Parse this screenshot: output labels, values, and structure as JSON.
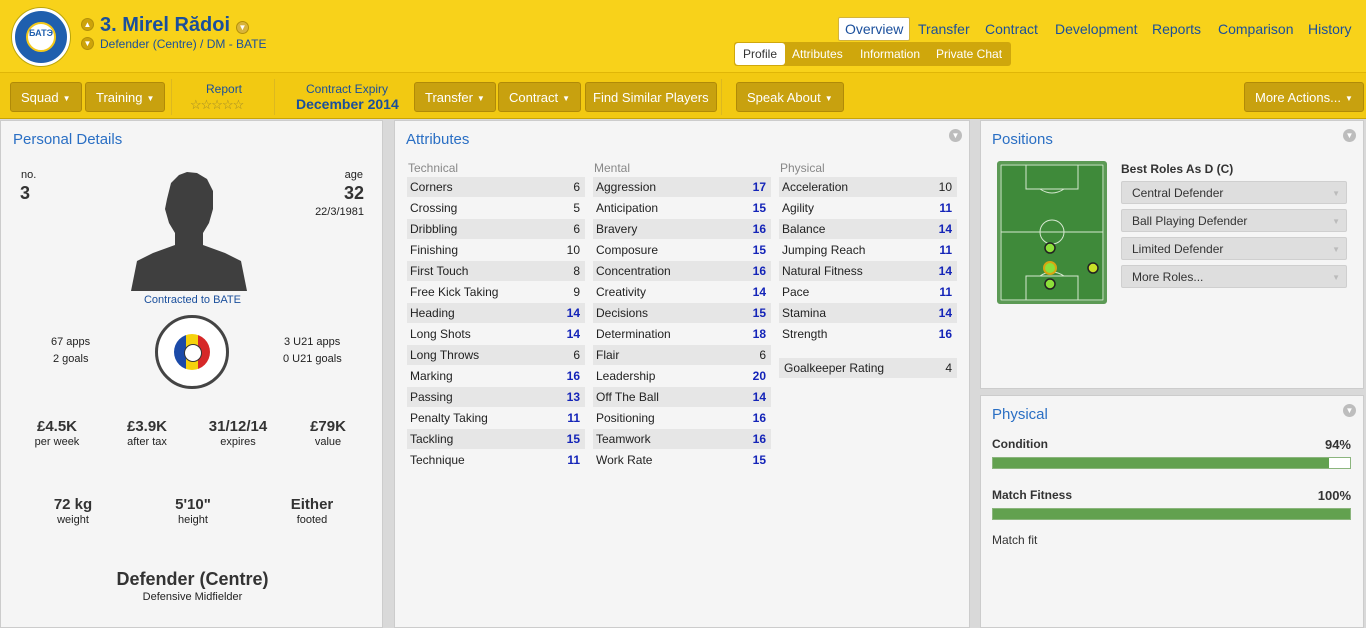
{
  "header": {
    "player_name": "3. Mirel Rădoi",
    "position_club": "Defender (Centre) / DM - BATE",
    "logo_text": "БАТЭ",
    "nav_tabs": [
      "Overview",
      "Transfer",
      "Contract",
      "Development",
      "Reports",
      "Comparison",
      "History"
    ],
    "sub_tabs": [
      "Profile",
      "Attributes",
      "Information",
      "Private Chat"
    ]
  },
  "toolbar": {
    "squad": "Squad",
    "training": "Training",
    "report_label": "Report",
    "report_stars": "☆☆☆☆☆",
    "contract_expiry_label": "Contract Expiry",
    "contract_expiry_value": "December 2014",
    "transfer": "Transfer",
    "contract": "Contract",
    "find_similar": "Find Similar Players",
    "speak_about": "Speak About",
    "more_actions": "More Actions..."
  },
  "personal": {
    "title": "Personal Details",
    "no_label": "no.",
    "no_value": "3",
    "age_label": "age",
    "age_value": "32",
    "dob": "22/3/1981",
    "contracted": "Contracted to BATE",
    "apps": "67 apps",
    "goals": "2 goals",
    "u21_apps": "3 U21 apps",
    "u21_goals": "0 U21 goals",
    "wage": "£4.5K",
    "wage_label": "per week",
    "after_tax": "£3.9K",
    "after_tax_label": "after tax",
    "expires": "31/12/14",
    "expires_label": "expires",
    "value": "£79K",
    "value_label": "value",
    "weight": "72 kg",
    "weight_label": "weight",
    "height": "5'10\"",
    "height_label": "height",
    "foot": "Either",
    "foot_label": "footed",
    "position_main": "Defender (Centre)",
    "position_sub": "Defensive Midfielder"
  },
  "attributes": {
    "title": "Attributes",
    "technical_label": "Technical",
    "mental_label": "Mental",
    "physical_label": "Physical",
    "technical": [
      {
        "name": "Corners",
        "value": "6"
      },
      {
        "name": "Crossing",
        "value": "5"
      },
      {
        "name": "Dribbling",
        "value": "6"
      },
      {
        "name": "Finishing",
        "value": "10"
      },
      {
        "name": "First Touch",
        "value": "8"
      },
      {
        "name": "Free Kick Taking",
        "value": "9"
      },
      {
        "name": "Heading",
        "value": "14"
      },
      {
        "name": "Long Shots",
        "value": "14"
      },
      {
        "name": "Long Throws",
        "value": "6"
      },
      {
        "name": "Marking",
        "value": "16"
      },
      {
        "name": "Passing",
        "value": "13"
      },
      {
        "name": "Penalty Taking",
        "value": "11"
      },
      {
        "name": "Tackling",
        "value": "15"
      },
      {
        "name": "Technique",
        "value": "11"
      }
    ],
    "mental": [
      {
        "name": "Aggression",
        "value": "17"
      },
      {
        "name": "Anticipation",
        "value": "15"
      },
      {
        "name": "Bravery",
        "value": "16"
      },
      {
        "name": "Composure",
        "value": "15"
      },
      {
        "name": "Concentration",
        "value": "16"
      },
      {
        "name": "Creativity",
        "value": "14"
      },
      {
        "name": "Decisions",
        "value": "15"
      },
      {
        "name": "Determination",
        "value": "18"
      },
      {
        "name": "Flair",
        "value": "6"
      },
      {
        "name": "Leadership",
        "value": "20"
      },
      {
        "name": "Off The Ball",
        "value": "14"
      },
      {
        "name": "Positioning",
        "value": "16"
      },
      {
        "name": "Teamwork",
        "value": "16"
      },
      {
        "name": "Work Rate",
        "value": "15"
      }
    ],
    "physical": [
      {
        "name": "Acceleration",
        "value": "10"
      },
      {
        "name": "Agility",
        "value": "11"
      },
      {
        "name": "Balance",
        "value": "14"
      },
      {
        "name": "Jumping Reach",
        "value": "11"
      },
      {
        "name": "Natural Fitness",
        "value": "14"
      },
      {
        "name": "Pace",
        "value": "11"
      },
      {
        "name": "Stamina",
        "value": "14"
      },
      {
        "name": "Strength",
        "value": "16"
      }
    ],
    "gk_rating_label": "Goalkeeper Rating",
    "gk_rating_value": "4"
  },
  "positions": {
    "title": "Positions",
    "best_roles_label": "Best Roles As D (C)",
    "roles": [
      "Central Defender",
      "Ball Playing Defender",
      "Limited Defender",
      "More Roles..."
    ]
  },
  "physical": {
    "title": "Physical",
    "condition_label": "Condition",
    "condition_value": "94%",
    "condition_fraction": 0.94,
    "fitness_label": "Match Fitness",
    "fitness_value": "100%",
    "fitness_fraction": 1.0,
    "status": "Match fit"
  },
  "colors": {
    "header_bg": "#f8d21a",
    "accent_blue": "#1a4f9c",
    "highlight_value": "#1424b8",
    "bar_green": "#62a14f"
  }
}
